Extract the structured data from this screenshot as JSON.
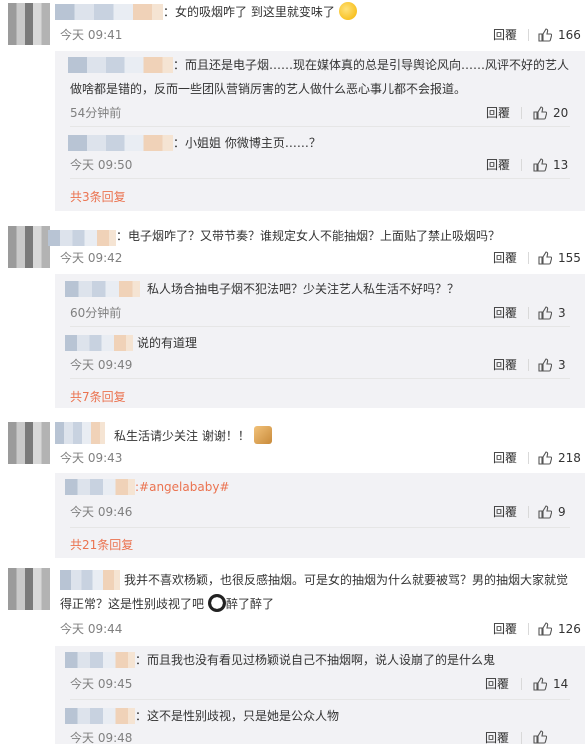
{
  "ui": {
    "reply_label": "回覆"
  },
  "comments": [
    {
      "text": "：女的吸烟咋了 到这里就变味了",
      "time": "今天 09:41",
      "likes": "166",
      "replies": [
        {
          "text": "：而且还是电子烟……现在媒体真的总是引导舆论风向……风评不好的艺人做啥都是错的，反而一些团队营销厉害的艺人做什么恶心事儿都不会报道。",
          "time": "54分钟前",
          "likes": "20"
        },
        {
          "text": "：小姐姐 你微博主页……？",
          "time": "今天 09:50",
          "likes": "13"
        }
      ],
      "more": "共3条回复"
    },
    {
      "text": "：电子烟咋了？又带节奏？谁规定女人不能抽烟？上面贴了禁止吸烟吗？",
      "time": "今天 09:42",
      "likes": "155",
      "replies": [
        {
          "text": "私人场合抽电子烟不犯法吧？少关注艺人私生活不好吗？？",
          "time": "60分钟前",
          "likes": "3"
        },
        {
          "text": "说的有道理",
          "time": "今天 09:49",
          "likes": "3"
        }
      ],
      "more": "共7条回复"
    },
    {
      "text": "私生活请少关注 谢谢！！",
      "time": "今天 09:43",
      "likes": "218",
      "replies": [
        {
          "text": ":#angelababy#",
          "time": "今天 09:46",
          "likes": "9"
        }
      ],
      "more": "共21条回复"
    },
    {
      "text": "我并不喜欢杨颖，也很反感抽烟。可是女的抽烟为什么就要被骂？男的抽烟大家就觉得正常？这是性别歧视了吧",
      "text_tail": "醉了醉了",
      "time": "今天 09:44",
      "likes": "126",
      "replies": [
        {
          "text": "：而且我也没有看见过杨颖说自己不抽烟啊，说人设崩了的是什么鬼",
          "time": "今天 09:45",
          "likes": "14"
        },
        {
          "text": "：这不是性别歧视，只是她是公众人物",
          "time": "今天 09:48",
          "likes": ""
        }
      ]
    }
  ],
  "colors": {
    "link": "#eb7350",
    "meta": "#808080",
    "reply_bg": "#f2f2f5"
  },
  "icons": {
    "like": "thumbs-up-icon",
    "emoji_shy": "shy-face-emoji",
    "emoji_pray": "praying-hands-emoji",
    "emoji_panda": "panda-face-emoji"
  }
}
